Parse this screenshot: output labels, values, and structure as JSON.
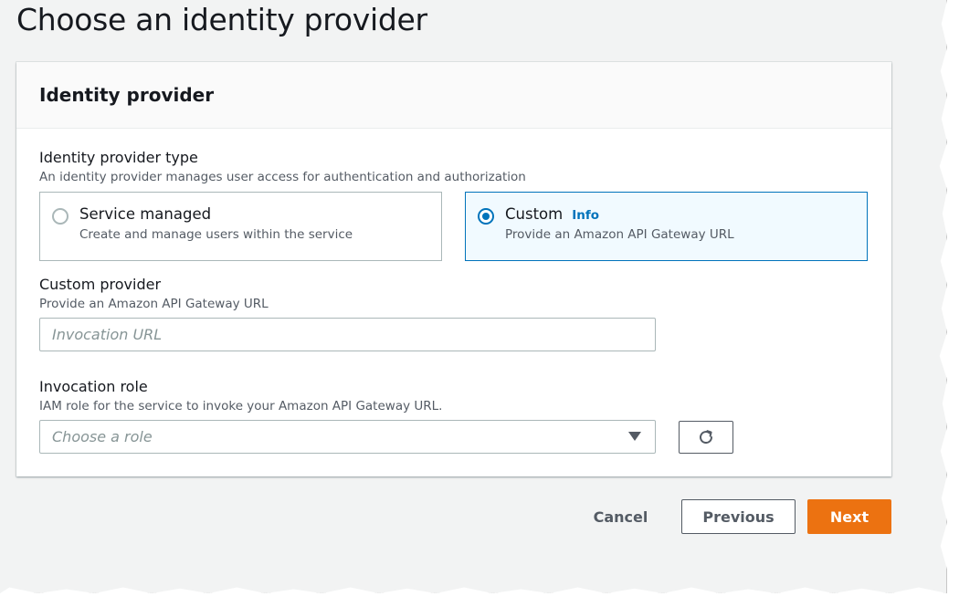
{
  "page": {
    "title": "Choose an identity provider"
  },
  "panel": {
    "header": "Identity provider",
    "provider_type": {
      "label": "Identity provider type",
      "description": "An identity provider manages user access for authentication and authorization",
      "options": [
        {
          "title": "Service managed",
          "description": "Create and manage users within the service",
          "selected": false
        },
        {
          "title": "Custom",
          "description": "Provide an Amazon API Gateway URL",
          "selected": true,
          "info_link": "Info"
        }
      ]
    },
    "custom_provider": {
      "label": "Custom provider",
      "description": "Provide an Amazon API Gateway URL",
      "value": "",
      "placeholder": "Invocation URL"
    },
    "invocation_role": {
      "label": "Invocation role",
      "description": "IAM role for the service to invoke your Amazon API Gateway URL.",
      "placeholder": "Choose a role",
      "refresh_icon": "refresh-icon"
    }
  },
  "footer": {
    "cancel_label": "Cancel",
    "previous_label": "Previous",
    "next_label": "Next"
  },
  "colors": {
    "primary": "#ec7211",
    "selection": "#0073bb",
    "selected_bg": "#f1faff",
    "text": "#16191f",
    "muted": "#545b64",
    "page_bg": "#f2f3f3"
  }
}
